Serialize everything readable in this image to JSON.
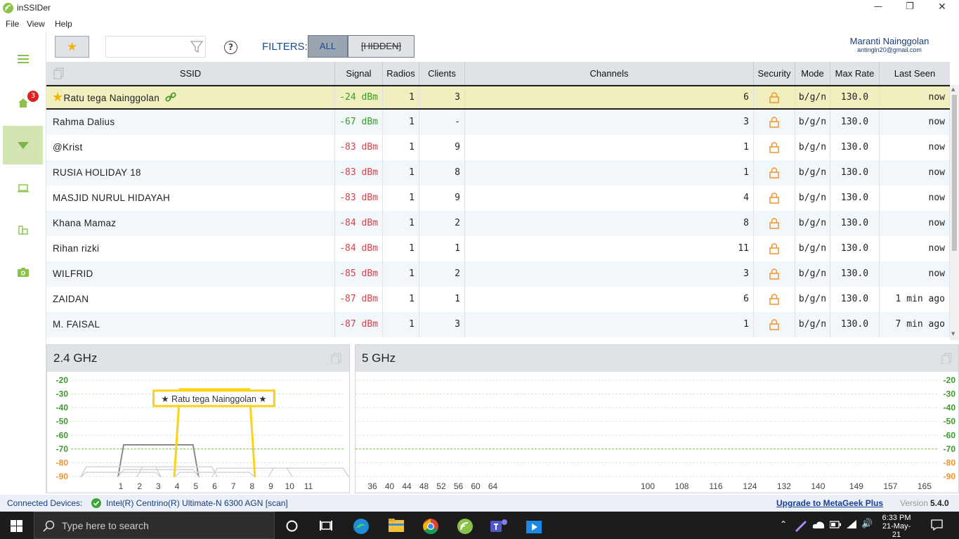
{
  "window": {
    "title": "inSSIDer",
    "minimize": "—",
    "restore": "❐",
    "close": "✕"
  },
  "menu": [
    "File",
    "View",
    "Help"
  ],
  "sidebar": {
    "badge_count": "3",
    "icons": [
      "hamburger-icon",
      "home-icon",
      "wifi-icon",
      "laptop-icon",
      "device-icon",
      "camera-icon"
    ]
  },
  "toolbar": {
    "search_placeholder": "",
    "filters_label": "FILTERS:",
    "filter_all": "ALL",
    "filter_hidden": "[HIDDEN]",
    "help": "?"
  },
  "user": {
    "name": "Maranti Nainggolan",
    "email": "antingln20@gmail.com"
  },
  "columns": [
    "SSID",
    "Signal",
    "Radios",
    "Clients",
    "Channels",
    "Security",
    "Mode",
    "Max Rate",
    "Last Seen"
  ],
  "rows": [
    {
      "ssid": "Ratu tega Nainggolan",
      "signal": "-24 dBm",
      "radios": "1",
      "clients": "3",
      "channels": "6",
      "mode": "b/g/n",
      "max_rate": "130.0",
      "last_seen": "now"
    },
    {
      "ssid": "Rahma Dalius",
      "signal": "-67 dBm",
      "radios": "1",
      "clients": "-",
      "channels": "3",
      "mode": "b/g/n",
      "max_rate": "130.0",
      "last_seen": "now"
    },
    {
      "ssid": "@Krist",
      "signal": "-83 dBm",
      "radios": "1",
      "clients": "9",
      "channels": "1",
      "mode": "b/g/n",
      "max_rate": "130.0",
      "last_seen": "now"
    },
    {
      "ssid": "RUSIA HOLIDAY 18",
      "signal": "-83 dBm",
      "radios": "1",
      "clients": "8",
      "channels": "1",
      "mode": "b/g/n",
      "max_rate": "130.0",
      "last_seen": "now"
    },
    {
      "ssid": "MASJID NURUL HIDAYAH",
      "signal": "-83 dBm",
      "radios": "1",
      "clients": "9",
      "channels": "4",
      "mode": "b/g/n",
      "max_rate": "130.0",
      "last_seen": "now"
    },
    {
      "ssid": "Khana Mamaz",
      "signal": "-84 dBm",
      "radios": "1",
      "clients": "2",
      "channels": "8",
      "mode": "b/g/n",
      "max_rate": "130.0",
      "last_seen": "now"
    },
    {
      "ssid": "Rihan rizki",
      "signal": "-84 dBm",
      "radios": "1",
      "clients": "1",
      "channels": "11",
      "mode": "b/g/n",
      "max_rate": "130.0",
      "last_seen": "now"
    },
    {
      "ssid": "WILFRID",
      "signal": "-85 dBm",
      "radios": "1",
      "clients": "2",
      "channels": "3",
      "mode": "b/g/n",
      "max_rate": "130.0",
      "last_seen": "now"
    },
    {
      "ssid": "ZAIDAN",
      "signal": "-87 dBm",
      "radios": "1",
      "clients": "1",
      "channels": "6",
      "mode": "b/g/n",
      "max_rate": "130.0",
      "last_seen": "1 min ago"
    },
    {
      "ssid": "M. FAISAL",
      "signal": "-87 dBm",
      "radios": "1",
      "clients": "3",
      "channels": "1",
      "mode": "b/g/n",
      "max_rate": "130.0",
      "last_seen": "7 min ago"
    }
  ],
  "colors": {
    "signal_good": "#3a9a2a",
    "signal_bad": "#d0434a",
    "lock": "#f0932b",
    "selected_row": "#f1efc0",
    "accent_green": "#8bc34a"
  },
  "chart_data": [
    {
      "type": "area",
      "title": "2.4 GHz",
      "y_ticks": [
        "-20",
        "-30",
        "-40",
        "-50",
        "-60",
        "-70",
        "-80",
        "-90"
      ],
      "x_ticks": [
        "1",
        "2",
        "3",
        "4",
        "5",
        "6",
        "7",
        "8",
        "9",
        "10",
        "11"
      ],
      "ylim": [
        -90,
        -20
      ],
      "highlight_label": "★ Ratu tega Nainggolan ★",
      "series": [
        {
          "center": 6,
          "signal": -24,
          "highlight": true
        },
        {
          "center": 3,
          "signal": -67
        },
        {
          "center": 1,
          "signal": -83
        },
        {
          "center": 1,
          "signal": -83
        },
        {
          "center": 4,
          "signal": -83
        },
        {
          "center": 8,
          "signal": -84
        },
        {
          "center": 11,
          "signal": -84
        },
        {
          "center": 3,
          "signal": -85
        },
        {
          "center": 6,
          "signal": -87
        },
        {
          "center": 1,
          "signal": -87
        }
      ]
    },
    {
      "type": "area",
      "title": "5 GHz",
      "y_ticks": [
        "-20",
        "-30",
        "-40",
        "-50",
        "-60",
        "-70",
        "-80",
        "-90"
      ],
      "x_ticks": [
        "36",
        "40",
        "44",
        "48",
        "52",
        "56",
        "60",
        "64",
        "100",
        "108",
        "116",
        "124",
        "132",
        "140",
        "149",
        "157",
        "165"
      ],
      "ylim": [
        -90,
        -20
      ],
      "series": []
    }
  ],
  "status": {
    "connected_label": "Connected Devices:",
    "device": "Intel(R) Centrino(R) Ultimate-N 6300 AGN [scan]",
    "upgrade": "Upgrade to MetaGeek Plus",
    "version_label": "Version",
    "version": "5.4.0"
  },
  "taskbar": {
    "search_placeholder": "Type here to search",
    "time": "6:33 PM",
    "date": "21-May-21"
  }
}
